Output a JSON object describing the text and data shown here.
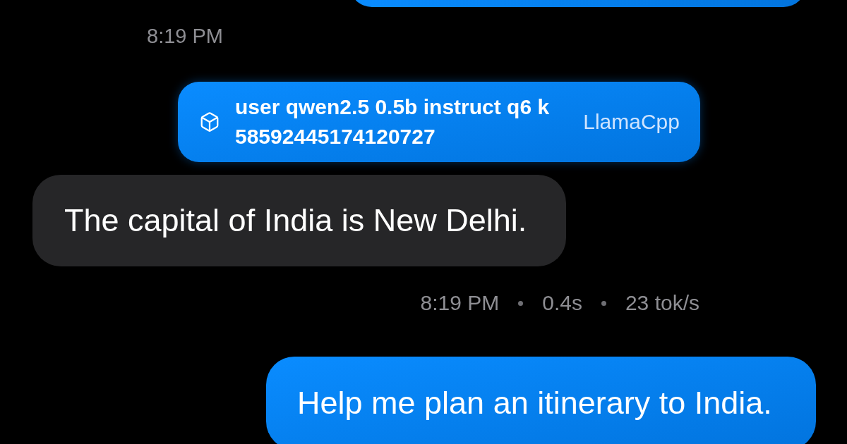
{
  "conversation": [
    {
      "kind": "user_message"
    },
    {
      "kind": "timestamp",
      "text": "8:19 PM"
    },
    {
      "kind": "model_card",
      "title": "user qwen2.5 0.5b instruct q6 k 58592445174120727",
      "engine": "LlamaCpp"
    },
    {
      "kind": "assistant_message",
      "text": "The capital of India is New Delhi."
    },
    {
      "kind": "message_meta",
      "items": [
        "8:19 PM",
        "0.4s",
        "23 tok/s"
      ]
    },
    {
      "kind": "user_message",
      "text": "Help me plan an itinerary to India."
    }
  ]
}
